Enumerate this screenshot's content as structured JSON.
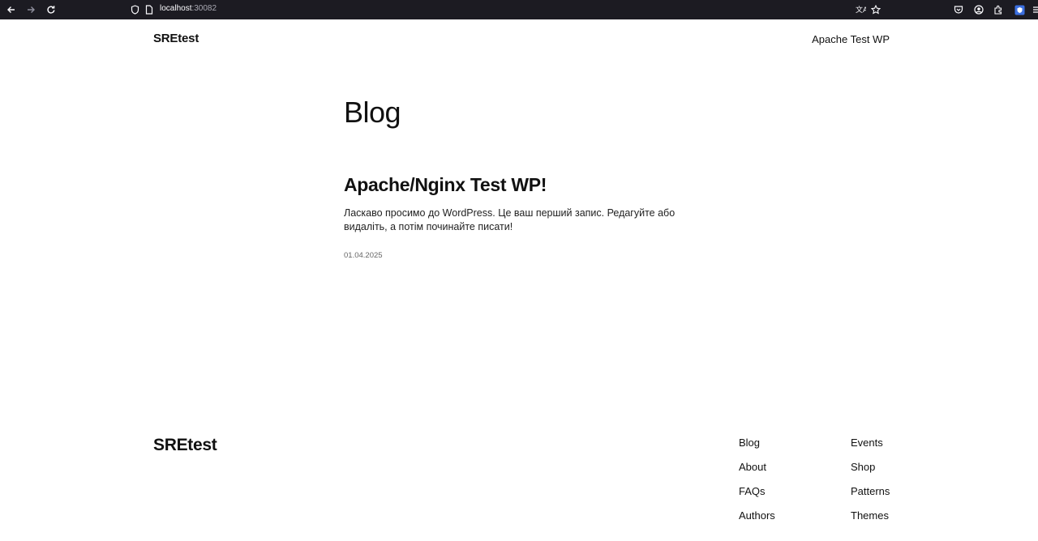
{
  "browser": {
    "url_host": "localhost",
    "url_port": ":30082"
  },
  "header": {
    "site_title": "SREtest",
    "nav_link": "Apache Test WP"
  },
  "main": {
    "heading": "Blog",
    "posts": [
      {
        "title": "Apache/Nginx Test WP!",
        "excerpt": "Ласкаво просимо до WordPress. Це ваш перший запис. Редагуйте або видаліть, а потім починайте писати!",
        "date": "01.04.2025"
      }
    ]
  },
  "footer": {
    "site_title": "SREtest",
    "col1": [
      "Blog",
      "About",
      "FAQs",
      "Authors"
    ],
    "col2": [
      "Events",
      "Shop",
      "Patterns",
      "Themes"
    ]
  }
}
